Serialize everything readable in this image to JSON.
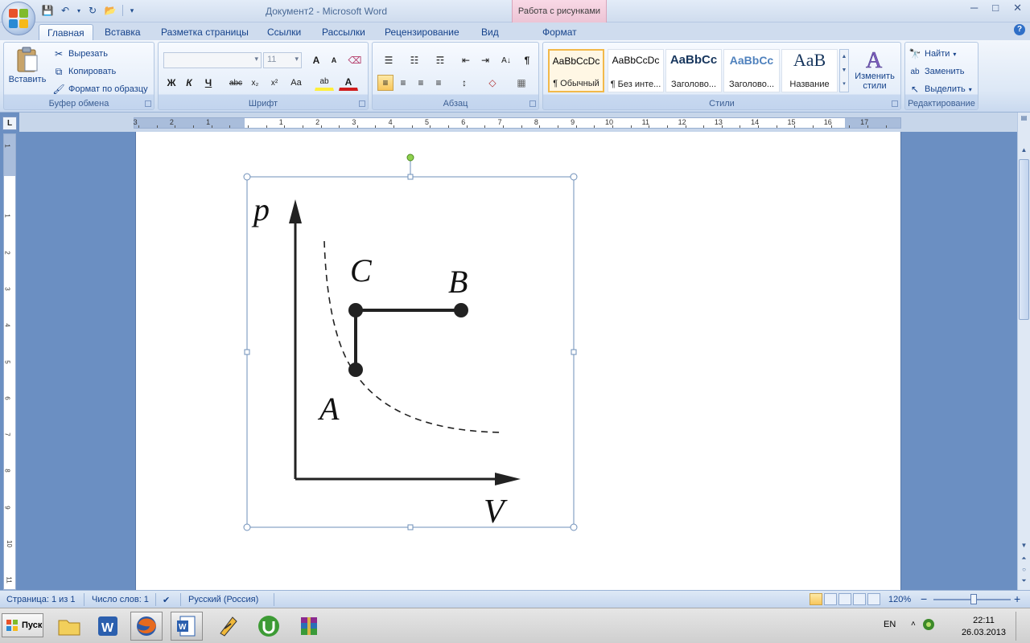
{
  "window": {
    "title": "Документ2 - Microsoft Word",
    "context_tab_title": "Работа с рисунками",
    "controls": {
      "minimize": "─",
      "maximize": "□",
      "close": "✕"
    }
  },
  "qat": {
    "save": "💾",
    "undo": "↶",
    "redo": "↻",
    "open": "📂",
    "more": "▾"
  },
  "tabs": [
    {
      "label": "Главная",
      "active": true
    },
    {
      "label": "Вставка"
    },
    {
      "label": "Разметка страницы"
    },
    {
      "label": "Ссылки"
    },
    {
      "label": "Рассылки"
    },
    {
      "label": "Рецензирование"
    },
    {
      "label": "Вид"
    },
    {
      "label": "Формат"
    }
  ],
  "help": "?",
  "ribbon": {
    "clipboard": {
      "label": "Буфер обмена",
      "paste": "Вставить",
      "cut": "Вырезать",
      "copy": "Копировать",
      "format_painter": "Формат по образцу"
    },
    "font": {
      "label": "Шрифт",
      "font_name": "",
      "font_size": "11",
      "grow": "A",
      "shrink": "A",
      "clear": "⌫",
      "bold": "Ж",
      "italic": "К",
      "underline": "Ч",
      "strike": "abc",
      "subscript": "x₂",
      "superscript": "x²",
      "case": "Aa",
      "highlight": "ab",
      "color": "A"
    },
    "paragraph": {
      "label": "Абзац",
      "bullets": "☰",
      "numbering": "☷",
      "multilevel": "☶",
      "decrease_indent": "⇤",
      "increase_indent": "⇥",
      "sort": "A↓",
      "pilcrow": "¶",
      "align_left": "≡",
      "align_center": "≡",
      "align_right": "≡",
      "justify": "≡",
      "line_spacing": "↕",
      "shading": "◇",
      "borders": "▦"
    },
    "styles": {
      "label": "Стили",
      "items": [
        {
          "sample": "AaBbCcDc",
          "name": "¶ Обычный",
          "selected": true
        },
        {
          "sample": "AaBbCcDc",
          "name": "¶ Без инте..."
        },
        {
          "sample": "AaBbCc",
          "name": "Заголово..."
        },
        {
          "sample": "AaBbCc",
          "name": "Заголово..."
        },
        {
          "sample": "AaB",
          "name": "Название"
        }
      ],
      "change_styles_line1": "Изменить",
      "change_styles_line2": "стили"
    },
    "editing": {
      "label": "Редактирование",
      "find": "Найти",
      "replace": "Заменить",
      "select": "Выделить"
    }
  },
  "ruler": {
    "tab_selector": "L",
    "h_numbers_left": [
      "3",
      "2",
      "1"
    ],
    "h_numbers_right": [
      "1",
      "2",
      "3",
      "4",
      "5",
      "6",
      "7",
      "8",
      "9",
      "10",
      "11",
      "12",
      "13",
      "14",
      "15",
      "16",
      "17"
    ],
    "v_numbers": [
      "1",
      "1",
      "2",
      "3",
      "4",
      "5",
      "6",
      "7",
      "8",
      "9",
      "10",
      "11"
    ]
  },
  "figure": {
    "axis_p": "p",
    "axis_v": "V",
    "point_a": "A",
    "point_b": "B",
    "point_c": "C"
  },
  "status": {
    "page": "Страница: 1 из 1",
    "words": "Число слов: 1",
    "language": "Русский (Россия)",
    "zoom": "120%",
    "zoom_minus": "−",
    "zoom_plus": "+"
  },
  "taskbar": {
    "start": "Пуск",
    "lang": "EN",
    "time": "22:11",
    "date": "26.03.2013"
  }
}
